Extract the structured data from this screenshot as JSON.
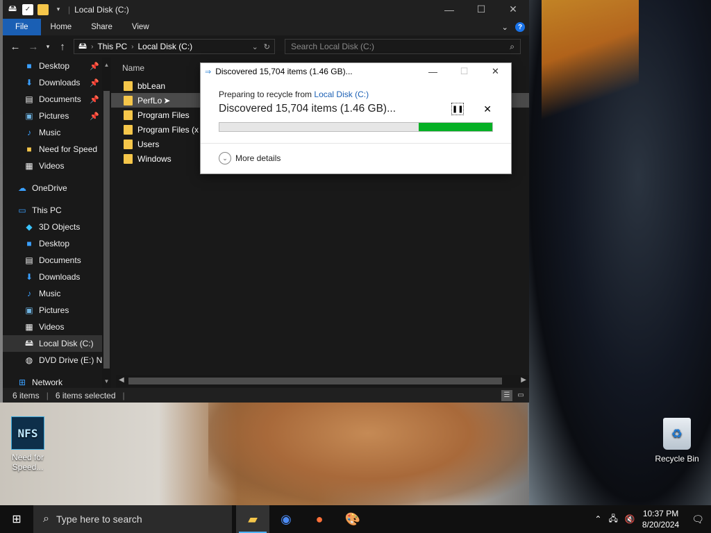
{
  "explorer": {
    "title": "Local Disk (C:)",
    "ribbon_tabs": [
      "File",
      "Home",
      "Share",
      "View"
    ],
    "breadcrumb": [
      "This PC",
      "Local Disk (C:)"
    ],
    "search_placeholder": "Search Local Disk (C:)",
    "column_name": "Name",
    "files": [
      "bbLean",
      "PerfLo",
      "Program Files",
      "Program Files (x",
      "Users",
      "Windows"
    ],
    "status_items": "6 items",
    "status_selected": "6 items selected"
  },
  "nav": {
    "quick_access": [
      "Desktop",
      "Downloads",
      "Documents",
      "Pictures",
      "Music",
      "Need for Speed",
      "Videos"
    ],
    "onedrive": "OneDrive",
    "this_pc": "This PC",
    "this_pc_items": [
      "3D Objects",
      "Desktop",
      "Documents",
      "Downloads",
      "Music",
      "Pictures",
      "Videos",
      "Local Disk (C:)",
      "DVD Drive (E:) N"
    ],
    "network": "Network"
  },
  "dialog": {
    "title": "Discovered 15,704 items (1.46 GB)...",
    "preparing_prefix": "Preparing to recycle from ",
    "preparing_link": "Local Disk (C:)",
    "headline": "Discovered 15,704 items (1.46 GB)...",
    "progress_fraction": 0.27,
    "more_details": "More details"
  },
  "desktop": {
    "nfs_label": "Need for Speed...",
    "nfs_logo": "NFS",
    "recycle_label": "Recycle Bin"
  },
  "taskbar": {
    "search_placeholder": "Type here to search",
    "time": "10:37 PM",
    "date": "8/20/2024"
  },
  "colors": {
    "accent": "#1a5fb4",
    "progress": "#06b025",
    "folder": "#f5c64a"
  }
}
